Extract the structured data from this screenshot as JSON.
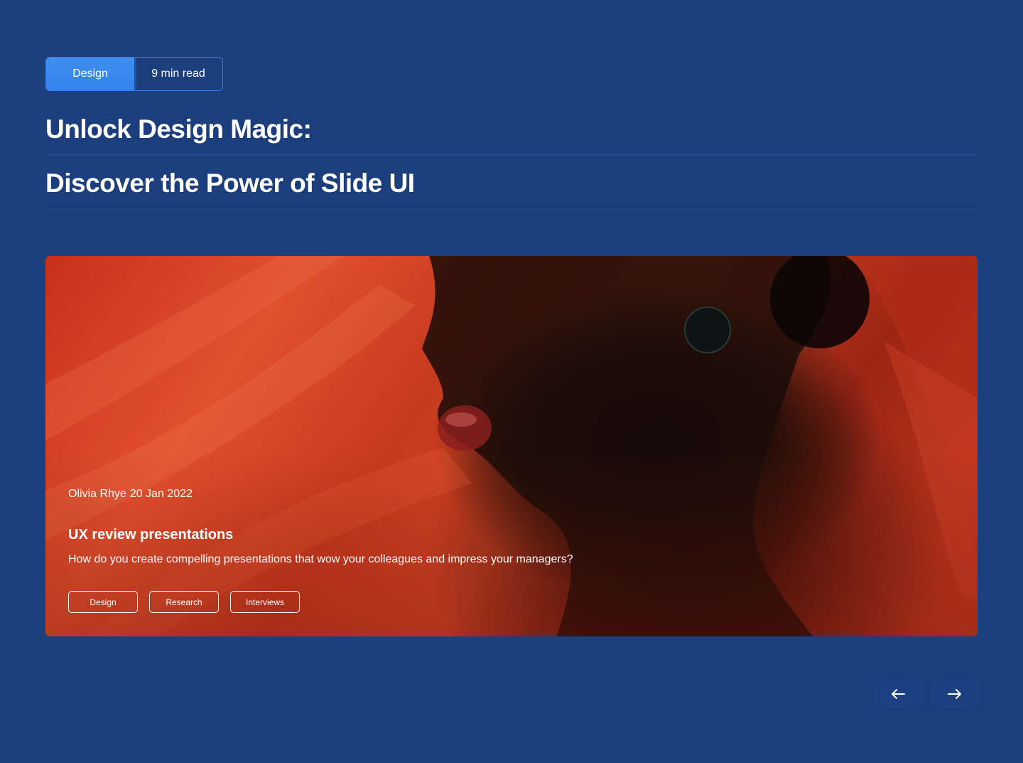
{
  "badge": {
    "category": "Design",
    "read_time": "9 min read"
  },
  "title": {
    "line1": "Unlock Design Magic:",
    "line2": "Discover the Power of Slide UI"
  },
  "hero": {
    "author": "Olivia Rhye",
    "date": "20 Jan 2022",
    "post_title": "UX review presentations",
    "description": "How do you create compelling presentations that wow your colleagues and impress your managers?",
    "tags": [
      "Design",
      "Research",
      "Interviews"
    ]
  },
  "navigation": {
    "prev_icon": "arrow-left-icon",
    "next_icon": "arrow-right-icon"
  },
  "colors": {
    "background": "#1c3e7c",
    "accent": "#3383ee",
    "hero_red": "#d24626"
  }
}
